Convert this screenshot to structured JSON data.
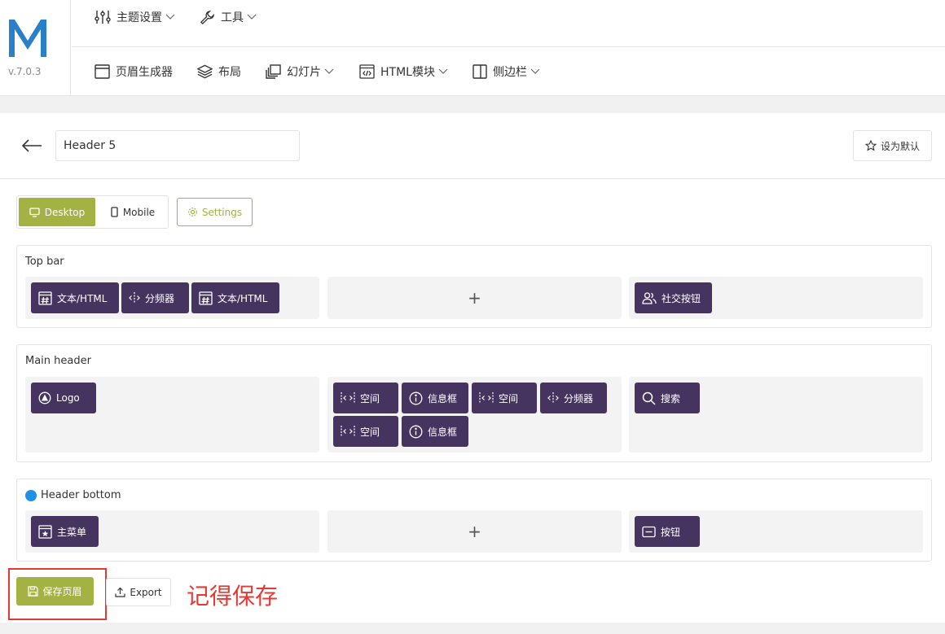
{
  "brand": {
    "version": "v.7.0.3",
    "logo_color": "#2a7fc9"
  },
  "nav_row1": [
    {
      "label": "主题设置",
      "icon": "sliders-icon",
      "dropdown": true
    },
    {
      "label": "工具",
      "icon": "wrench-icon",
      "dropdown": true
    }
  ],
  "nav_row2": [
    {
      "label": "页眉生成器",
      "icon": "window-icon",
      "dropdown": false
    },
    {
      "label": "布局",
      "icon": "layers-icon",
      "dropdown": false
    },
    {
      "label": "幻灯片",
      "icon": "slides-icon",
      "dropdown": true
    },
    {
      "label": "HTML模块",
      "icon": "code-icon",
      "dropdown": true
    },
    {
      "label": "侧边栏",
      "icon": "sidebar-icon",
      "dropdown": true
    }
  ],
  "header": {
    "name_value": "Header 5",
    "set_default_label": "设为默认"
  },
  "devices": {
    "desktop_label": "Desktop",
    "mobile_label": "Mobile",
    "settings_label": "Settings"
  },
  "sections": {
    "top_bar": {
      "title": "Top bar",
      "left": [
        {
          "label": "文本/HTML",
          "icon": "hash-icon"
        },
        {
          "label": "分频器",
          "icon": "divider-icon"
        },
        {
          "label": "文本/HTML",
          "icon": "hash-icon"
        }
      ],
      "center_add": "+",
      "right": [
        {
          "label": "社交按钮",
          "icon": "users-icon"
        }
      ]
    },
    "main_header": {
      "title": "Main header",
      "left": [
        {
          "label": "Logo",
          "icon": "logo-icon"
        }
      ],
      "center": [
        {
          "label": "空间",
          "icon": "space-icon"
        },
        {
          "label": "信息框",
          "icon": "info-icon"
        },
        {
          "label": "空间",
          "icon": "space-icon"
        },
        {
          "label": "分频器",
          "icon": "divider-icon"
        },
        {
          "label": "空间",
          "icon": "space-icon"
        },
        {
          "label": "信息框",
          "icon": "info-icon"
        }
      ],
      "right": [
        {
          "label": "搜索",
          "icon": "search-icon"
        }
      ]
    },
    "header_bottom": {
      "title": "Header bottom",
      "left": [
        {
          "label": "主菜单",
          "icon": "menu-icon"
        }
      ],
      "center_add": "+",
      "right": [
        {
          "label": "按钮",
          "icon": "button-icon"
        }
      ]
    }
  },
  "footer": {
    "save_label": "保存页眉",
    "export_label": "Export",
    "annotation": "记得保存"
  },
  "colors": {
    "accent": "#a4b243",
    "element_bg": "#45345f",
    "annotation": "#e53935",
    "status_dot": "#1e90e6"
  }
}
